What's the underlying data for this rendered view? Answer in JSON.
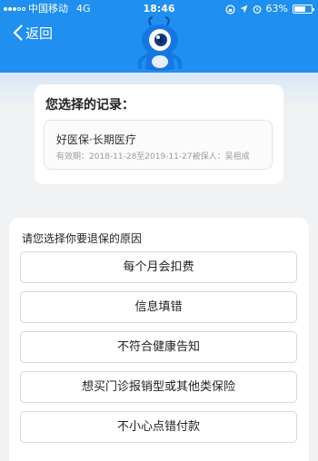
{
  "status_bar": {
    "carrier": "中国移动",
    "network": "4G",
    "time": "18:46",
    "battery": "63%"
  },
  "nav": {
    "back_label": "返回"
  },
  "record_card": {
    "title": "您选择的记录：",
    "product_name": "好医保·长期医疗",
    "validity": "有效期：2018-11-28至2019-11-27被保人：吴祖成"
  },
  "reasons": {
    "prompt": "请您选择你要退保的原因",
    "options": [
      "每个月会扣费",
      "信息填错",
      "不符合健康告知",
      "想买门诊报销型或其他类保险",
      "不小心点错付款"
    ]
  },
  "colors": {
    "header_blue": "#1f8ff0",
    "mascot_blue": "#1677e0"
  }
}
